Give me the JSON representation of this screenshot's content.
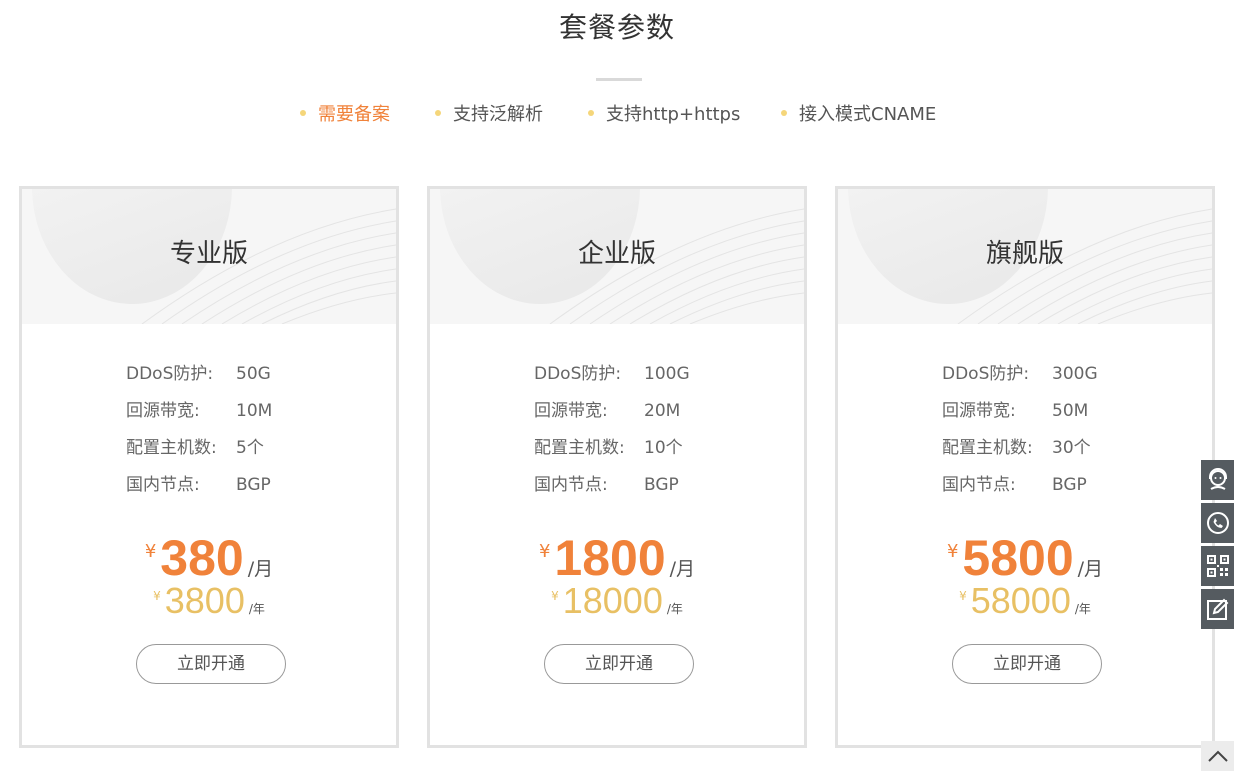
{
  "section": {
    "title": "套餐参数"
  },
  "features": [
    {
      "label": "需要备案",
      "active": true
    },
    {
      "label": "支持泛解析",
      "active": false
    },
    {
      "label": "支持http+https",
      "active": false
    },
    {
      "label": "接入模式CNAME",
      "active": false
    }
  ],
  "plans": [
    {
      "name": "专业版",
      "specs": [
        {
          "key": "DDoS防护:",
          "value": "50G"
        },
        {
          "key": "回源带宽:",
          "value": "10M"
        },
        {
          "key": "配置主机数:",
          "value": "5个"
        },
        {
          "key": "国内节点:",
          "value": "BGP"
        }
      ],
      "currency": "¥",
      "price_month": "380",
      "month_unit": "/月",
      "price_year": "3800",
      "year_unit": "/年",
      "button": "立即开通"
    },
    {
      "name": "企业版",
      "specs": [
        {
          "key": "DDoS防护:",
          "value": "100G"
        },
        {
          "key": "回源带宽:",
          "value": "20M"
        },
        {
          "key": "配置主机数:",
          "value": "10个"
        },
        {
          "key": "国内节点:",
          "value": "BGP"
        }
      ],
      "currency": "¥",
      "price_month": "1800",
      "month_unit": "/月",
      "price_year": "18000",
      "year_unit": "/年",
      "button": "立即开通"
    },
    {
      "name": "旗舰版",
      "specs": [
        {
          "key": "DDoS防护:",
          "value": "300G"
        },
        {
          "key": "回源带宽:",
          "value": "50M"
        },
        {
          "key": "配置主机数:",
          "value": "30个"
        },
        {
          "key": "国内节点:",
          "value": "BGP"
        }
      ],
      "currency": "¥",
      "price_month": "5800",
      "month_unit": "/月",
      "price_year": "58000",
      "year_unit": "/年",
      "button": "立即开通"
    }
  ],
  "sidebar_icons": [
    "customer-service-icon",
    "phone-icon",
    "qrcode-icon",
    "edit-icon"
  ],
  "back_to_top_icon": "chevron-up-icon",
  "colors": {
    "accent_orange": "#f0823a",
    "accent_gold": "#e8c064",
    "dot_yellow": "#f5d67a",
    "sidebar_bg": "#555b60",
    "card_border": "#e2e2e2"
  }
}
